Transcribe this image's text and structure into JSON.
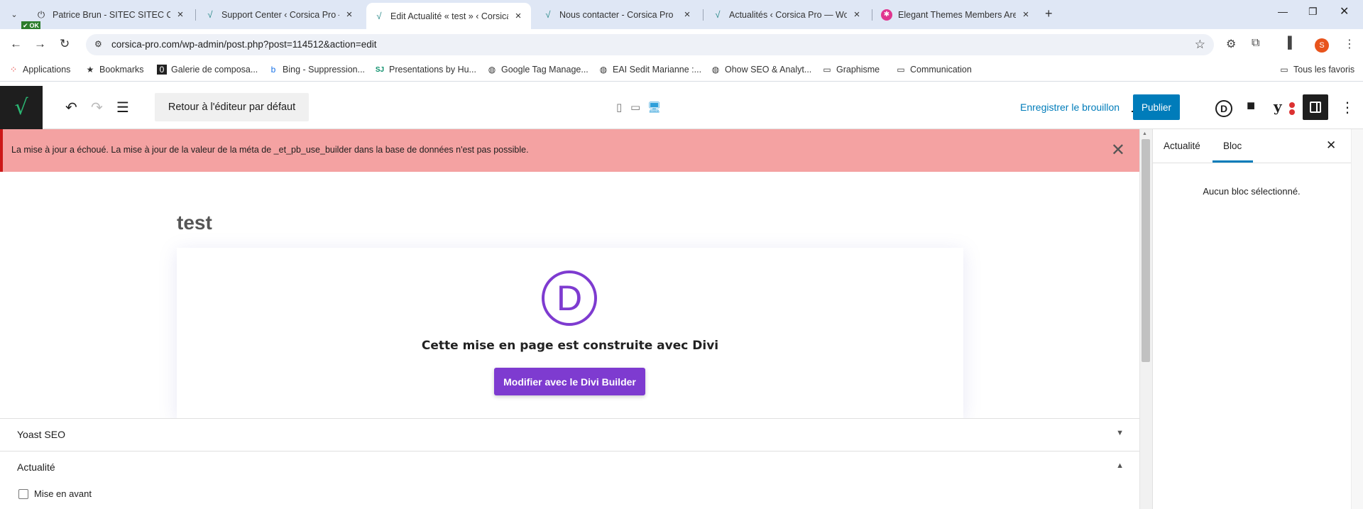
{
  "browser": {
    "ok_badge": "OK",
    "tabs": [
      {
        "title": "Patrice Brun - SITEC SITEC CHA",
        "icon": "power-icon"
      },
      {
        "title": "Support Center ‹ Corsica Pro —",
        "icon": "corsica-check-icon"
      },
      {
        "title": "Edit Actualité « test » ‹ Corsica P",
        "icon": "corsica-check-icon",
        "active": true
      },
      {
        "title": "Nous contacter - Corsica Pro",
        "icon": "corsica-check-icon"
      },
      {
        "title": "Actualités ‹ Corsica Pro — Word",
        "icon": "corsica-check-icon"
      },
      {
        "title": "Elegant Themes Members Area",
        "icon": "elegant-themes-icon"
      }
    ],
    "url": "corsica-pro.com/wp-admin/post.php?post=114512&action=edit",
    "profile_initial": "S",
    "bookmarks": [
      {
        "label": "Applications",
        "icon": "apps-grid-icon"
      },
      {
        "label": "Bookmarks",
        "icon": "star-icon"
      },
      {
        "label": "Galerie de composa...",
        "icon": "zero-icon"
      },
      {
        "label": "Bing - Suppression...",
        "icon": "bing-icon"
      },
      {
        "label": "Presentations by Hu...",
        "icon": "sj-icon"
      },
      {
        "label": "Google Tag Manage...",
        "icon": "globe-icon"
      },
      {
        "label": "EAI Sedit Marianne :...",
        "icon": "globe-icon"
      },
      {
        "label": "Ohow SEO & Analyt...",
        "icon": "globe-icon"
      },
      {
        "label": "Graphisme",
        "icon": "folder-icon"
      },
      {
        "label": "Communication",
        "icon": "folder-icon"
      }
    ],
    "all_bookmarks": "Tous les favoris"
  },
  "editor": {
    "back_to_default": "Retour à l'éditeur par défaut",
    "save_draft": "Enregistrer le brouillon",
    "publish": "Publier",
    "divi_letter": "D",
    "notice": "La mise à jour a échoué. La mise à jour de la valeur de la méta de _et_pb_use_builder dans la base de données n'est pas possible.",
    "post_title": "test",
    "divi_logo_letter": "D",
    "divi_message": "Cette mise en page est construite avec Divi",
    "divi_button": "Modifier avec le Divi Builder",
    "meta_boxes": [
      {
        "label": "Yoast SEO",
        "arrow": "▼"
      },
      {
        "label": "Actualité",
        "arrow": "▲"
      }
    ],
    "featured_checkbox": "Mise en avant"
  },
  "sidebar": {
    "tabs": [
      "Actualité",
      "Bloc"
    ],
    "empty_message": "Aucun bloc sélectionné."
  }
}
